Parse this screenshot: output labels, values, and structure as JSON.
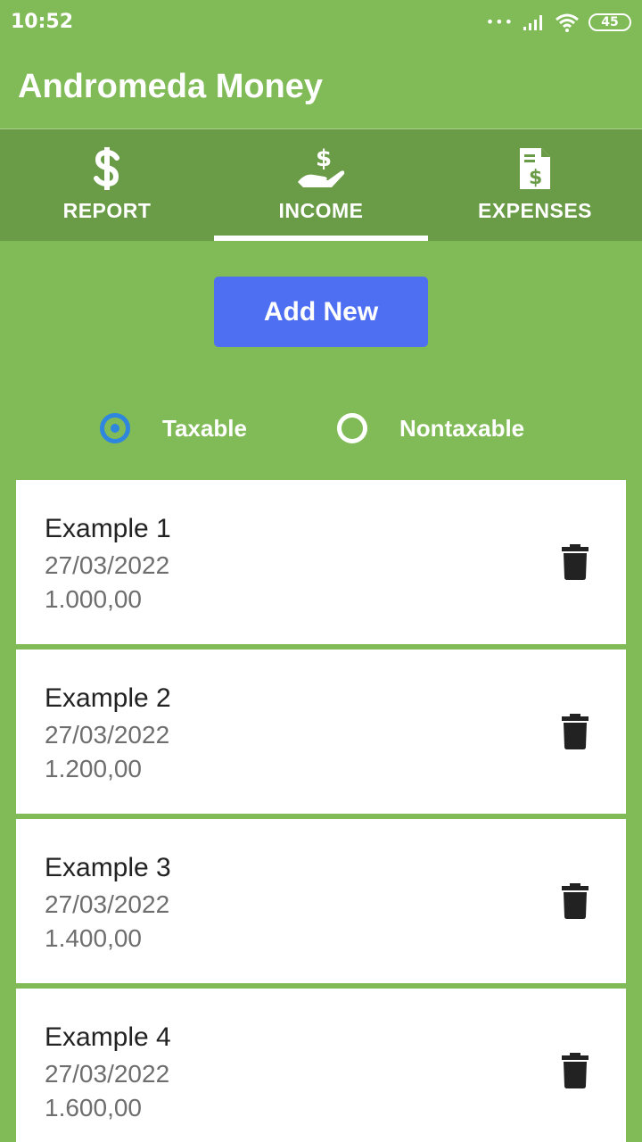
{
  "status_bar": {
    "time": "10:52",
    "signal_dots": "•••",
    "battery": "45"
  },
  "app": {
    "title": "Andromeda Money"
  },
  "tabs": [
    {
      "label": "REPORT",
      "icon": "dollar-icon",
      "selected": false
    },
    {
      "label": "INCOME",
      "icon": "hand-money-icon",
      "selected": true
    },
    {
      "label": "EXPENSES",
      "icon": "invoice-icon",
      "selected": false
    }
  ],
  "add_button": {
    "label": "Add New",
    "color": "#4f6ff2"
  },
  "filter": {
    "options": [
      {
        "label": "Taxable",
        "checked": true
      },
      {
        "label": "Nontaxable",
        "checked": false
      }
    ]
  },
  "entries": [
    {
      "title": "Example 1",
      "date": "27/03/2022",
      "amount": "1.000,00"
    },
    {
      "title": "Example 2",
      "date": "27/03/2022",
      "amount": "1.200,00"
    },
    {
      "title": "Example 3",
      "date": "27/03/2022",
      "amount": "1.400,00"
    },
    {
      "title": "Example 4",
      "date": "27/03/2022",
      "amount": "1.600,00"
    }
  ],
  "colors": {
    "background": "#80bb57",
    "tab_bar": "#6a9c48",
    "radio_accent": "#2e86de"
  }
}
